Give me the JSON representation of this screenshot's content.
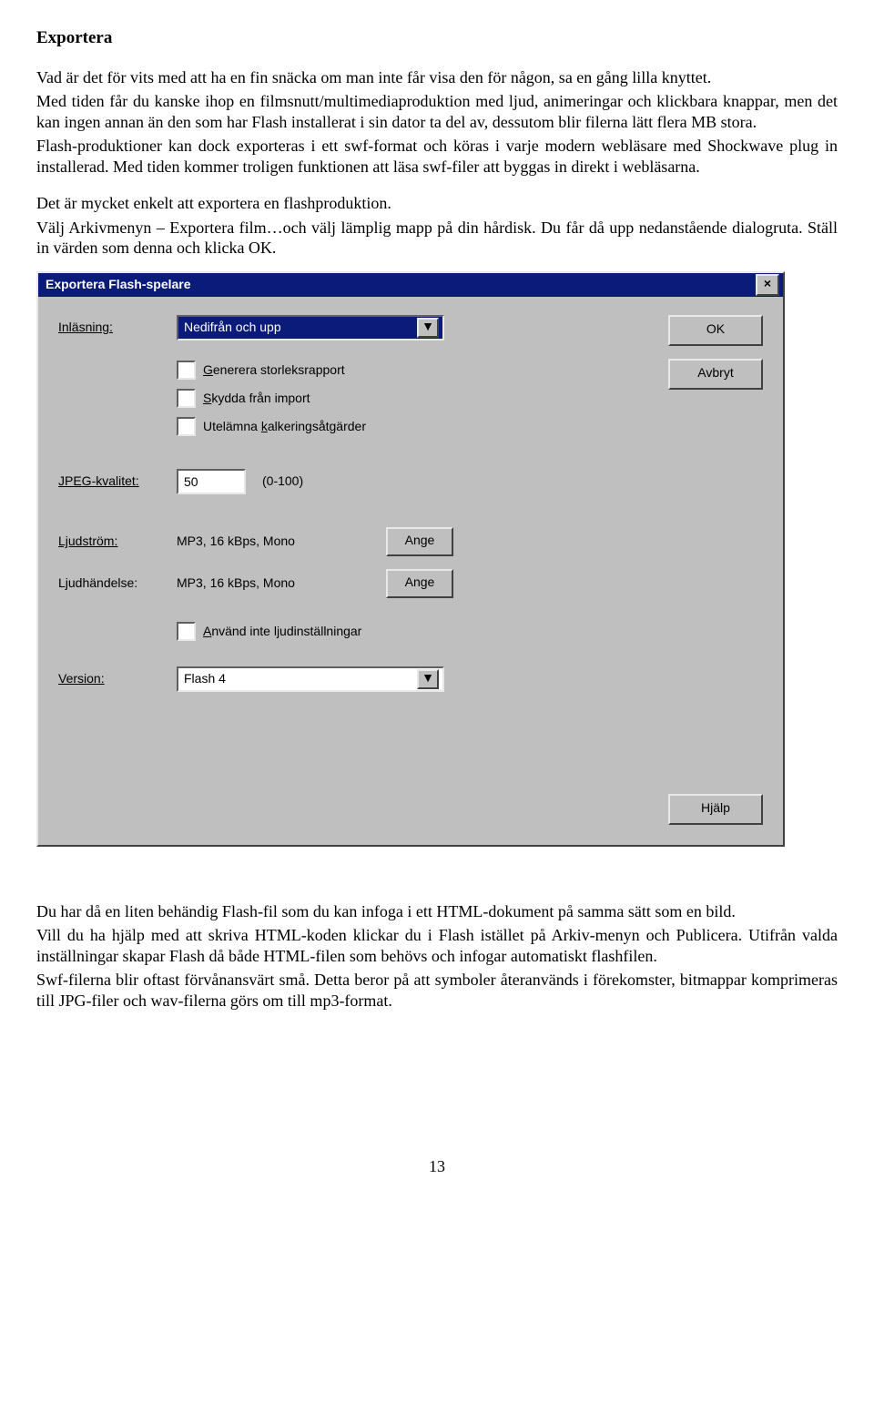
{
  "doc": {
    "heading": "Exportera",
    "p1": "Vad är det för vits med att ha en fin snäcka om man inte får visa den för någon, sa en gång lilla knyttet.",
    "p2": "Med tiden får du kanske ihop en filmsnutt/multimediaproduktion med ljud, animeringar och klickbara knappar, men det kan ingen annan än den som har Flash installerat i sin dator ta del av, dessutom blir filerna lätt flera MB stora.",
    "p3": "Flash-produktioner kan dock exporteras i ett swf-format och köras i varje modern webläsare med Shockwave plug in installerad. Med tiden kommer troligen funktionen att läsa swf-filer att byggas in direkt i webläsarna.",
    "p4": "Det är mycket enkelt att exportera en flashproduktion.",
    "p5": "Välj Arkivmenyn – Exportera film…och välj lämplig mapp på din hårdisk. Du får då upp nedanstående dialogruta. Ställ in värden som denna och klicka OK.",
    "p6": "Du har då en liten behändig Flash-fil som du kan infoga i ett HTML-dokument på samma sätt som en bild.",
    "p7": "Vill du ha hjälp med att skriva HTML-koden klickar du i Flash istället på Arkiv-menyn och Publicera. Utifrån valda inställningar skapar Flash då både HTML-filen som behövs och infogar automatiskt flashfilen.",
    "p8": "Swf-filerna blir oftast förvånansvärt små. Detta beror på att symboler återanvänds i förekomster, bitmappar komprimeras till JPG-filer och wav-filerna görs om till mp3-format.",
    "pagenum": "13"
  },
  "dialog": {
    "title": "Exportera Flash-spelare",
    "labels": {
      "inlasning": "Inläsning:",
      "jpeg": "JPEG-kvalitet:",
      "ljudstrom": "Ljudström:",
      "ljudhandelse": "Ljudhändelse:",
      "version": "Version:"
    },
    "inlasning_value": "Nedifrån och upp",
    "chk_generera": "Generera storleksrapport",
    "chk_skydda": "Skydda från import",
    "chk_utelamna": "Utelämna kalkeringsåtgärder",
    "chk_ljud": "Använd inte ljudinställningar",
    "jpeg_value": "50",
    "jpeg_range": "(0-100)",
    "audio1": "MP3, 16 kBps, Mono",
    "audio2": "MP3, 16 kBps, Mono",
    "version_value": "Flash 4",
    "btn_ok": "OK",
    "btn_avbryt": "Avbryt",
    "btn_ange": "Ange",
    "btn_hjalp": "Hjälp"
  }
}
